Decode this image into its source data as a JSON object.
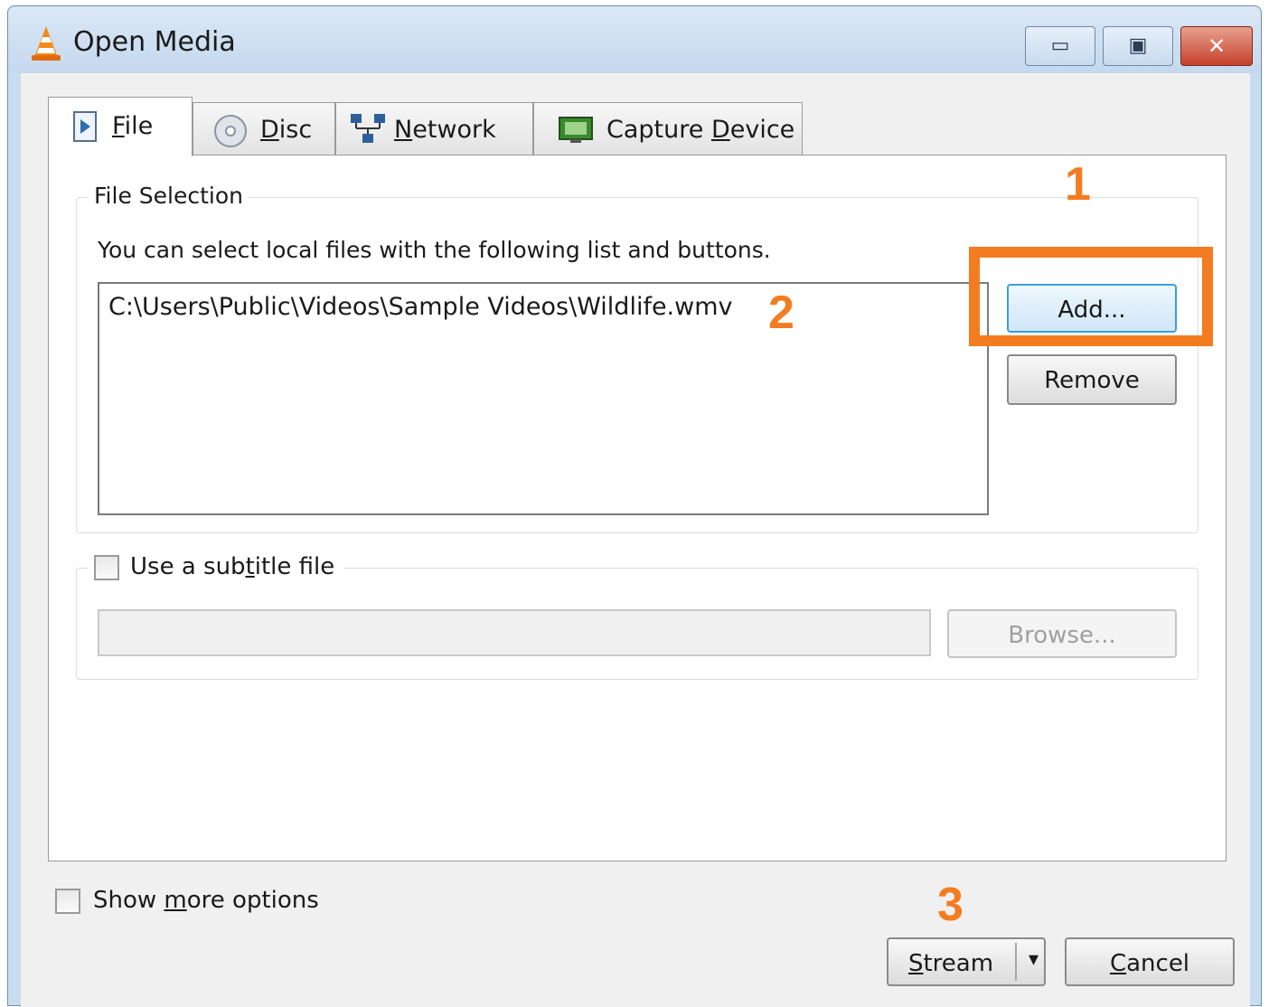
{
  "window": {
    "title": "Open Media"
  },
  "tabs": [
    {
      "label": "File",
      "mnemonic": "F",
      "rest": "ile",
      "icon": "file-icon",
      "active": true
    },
    {
      "label": "Disc",
      "mnemonic": "D",
      "rest": "isc",
      "icon": "disc-icon",
      "active": false
    },
    {
      "label": "Network",
      "mnemonic": "N",
      "rest": "etwork",
      "icon": "network-icon",
      "active": false
    },
    {
      "label": "Capture Device",
      "pre": "Capture ",
      "mnemonic": "D",
      "rest": "evice",
      "icon": "capture-device-icon",
      "active": false
    }
  ],
  "file_selection": {
    "legend": "File Selection",
    "hint": "You can select local files with the following list and buttons.",
    "files": [
      "C:\\Users\\Public\\Videos\\Sample Videos\\Wildlife.wmv"
    ],
    "add_label": "Add...",
    "remove_label": "Remove"
  },
  "subtitle": {
    "label_pre": "Use a sub",
    "label_mnemonic": "t",
    "label_post": "itle file",
    "checked": false,
    "path_value": "",
    "browse_label": "Browse..."
  },
  "options": {
    "show_more_pre": "Show ",
    "show_more_mnemonic": "m",
    "show_more_post": "ore options",
    "checked": false
  },
  "footer": {
    "stream_mnemonic": "S",
    "stream_rest": "tream",
    "cancel_mnemonic": "C",
    "cancel_rest": "ancel"
  },
  "annotations": {
    "step1": "1",
    "step2": "2",
    "step3": "3",
    "highlight_color": "#f47c20"
  },
  "colors": {
    "accent_orange": "#f47c20",
    "focus_blue": "#3c9fd8",
    "titlebar": "#c8dcef",
    "close_red": "#c5412b"
  }
}
